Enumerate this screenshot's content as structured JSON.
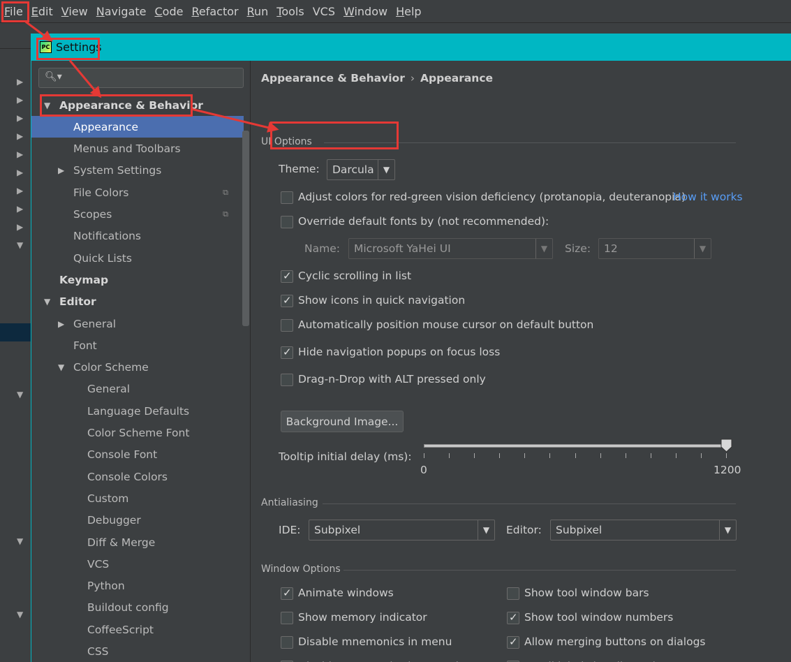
{
  "menu": {
    "items": [
      {
        "label": "File",
        "u": "F",
        "rest": "ile"
      },
      {
        "label": "Edit",
        "u": "E",
        "rest": "dit"
      },
      {
        "label": "View",
        "u": "V",
        "rest": "iew"
      },
      {
        "label": "Navigate",
        "u": "N",
        "rest": "avigate"
      },
      {
        "label": "Code",
        "u": "C",
        "rest": "ode"
      },
      {
        "label": "Refactor",
        "u": "R",
        "rest": "efactor"
      },
      {
        "label": "Run",
        "u": "R",
        "rest": "un"
      },
      {
        "label": "Tools",
        "u": "T",
        "rest": "ools"
      },
      {
        "label": "VCS",
        "u": "",
        "rest": "VCS"
      },
      {
        "label": "Window",
        "u": "W",
        "rest": "indow"
      },
      {
        "label": "Help",
        "u": "H",
        "rest": "elp"
      }
    ]
  },
  "dialog": {
    "title": "Settings",
    "search_placeholder": "",
    "tree": [
      {
        "label": "Appearance & Behavior",
        "level": 0,
        "arrow": "▼",
        "bold": true,
        "selected": false
      },
      {
        "label": "Appearance",
        "level": 1,
        "arrow": "",
        "bold": false,
        "selected": true
      },
      {
        "label": "Menus and Toolbars",
        "level": 1,
        "arrow": "",
        "bold": false,
        "selected": false
      },
      {
        "label": "System Settings",
        "level": 1,
        "arrow": "▶",
        "bold": false,
        "selected": false
      },
      {
        "label": "File Colors",
        "level": 1,
        "arrow": "",
        "bold": false,
        "selected": false,
        "copy": true
      },
      {
        "label": "Scopes",
        "level": 1,
        "arrow": "",
        "bold": false,
        "selected": false,
        "copy": true
      },
      {
        "label": "Notifications",
        "level": 1,
        "arrow": "",
        "bold": false,
        "selected": false
      },
      {
        "label": "Quick Lists",
        "level": 1,
        "arrow": "",
        "bold": false,
        "selected": false
      },
      {
        "label": "Keymap",
        "level": 0,
        "arrow": "",
        "bold": true,
        "selected": false
      },
      {
        "label": "Editor",
        "level": 0,
        "arrow": "▼",
        "bold": true,
        "selected": false
      },
      {
        "label": "General",
        "level": 1,
        "arrow": "▶",
        "bold": false,
        "selected": false
      },
      {
        "label": "Font",
        "level": 1,
        "arrow": "",
        "bold": false,
        "selected": false
      },
      {
        "label": "Color Scheme",
        "level": 1,
        "arrow": "▼",
        "bold": false,
        "selected": false
      },
      {
        "label": "General",
        "level": 2,
        "arrow": "",
        "bold": false,
        "selected": false
      },
      {
        "label": "Language Defaults",
        "level": 2,
        "arrow": "",
        "bold": false,
        "selected": false
      },
      {
        "label": "Color Scheme Font",
        "level": 2,
        "arrow": "",
        "bold": false,
        "selected": false
      },
      {
        "label": "Console Font",
        "level": 2,
        "arrow": "",
        "bold": false,
        "selected": false
      },
      {
        "label": "Console Colors",
        "level": 2,
        "arrow": "",
        "bold": false,
        "selected": false
      },
      {
        "label": "Custom",
        "level": 2,
        "arrow": "",
        "bold": false,
        "selected": false
      },
      {
        "label": "Debugger",
        "level": 2,
        "arrow": "",
        "bold": false,
        "selected": false
      },
      {
        "label": "Diff & Merge",
        "level": 2,
        "arrow": "",
        "bold": false,
        "selected": false
      },
      {
        "label": "VCS",
        "level": 2,
        "arrow": "",
        "bold": false,
        "selected": false
      },
      {
        "label": "Python",
        "level": 2,
        "arrow": "",
        "bold": false,
        "selected": false
      },
      {
        "label": "Buildout config",
        "level": 2,
        "arrow": "",
        "bold": false,
        "selected": false
      },
      {
        "label": "CoffeeScript",
        "level": 2,
        "arrow": "",
        "bold": false,
        "selected": false
      },
      {
        "label": "CSS",
        "level": 2,
        "arrow": "",
        "bold": false,
        "selected": false
      }
    ]
  },
  "content": {
    "breadcrumb_parent": "Appearance & Behavior",
    "breadcrumb_sep": "›",
    "breadcrumb_current": "Appearance",
    "ui_options": {
      "section": "UI Options",
      "theme_label": "Theme:",
      "theme_value": "Darcula",
      "adjust_colors": {
        "label": "Adjust colors for red-green vision deficiency (protanopia, deuteranopia)",
        "checked": false
      },
      "how_it_works": "How it works",
      "override_fonts": {
        "label": "Override default fonts by (not recommended):",
        "checked": false
      },
      "name_label": "Name:",
      "name_value": "Microsoft YaHei UI",
      "size_label": "Size:",
      "size_value": "12",
      "cyclic": {
        "label": "Cyclic scrolling in list",
        "checked": true
      },
      "show_icons": {
        "label": "Show icons in quick navigation",
        "checked": true
      },
      "auto_position": {
        "label": "Automatically position mouse cursor on default button",
        "checked": false
      },
      "hide_nav": {
        "label": "Hide navigation popups on focus loss",
        "checked": true
      },
      "drag_drop": {
        "label": "Drag-n-Drop with ALT pressed only",
        "checked": false
      },
      "background_image": "Background Image...",
      "tooltip_label": "Tooltip initial delay (ms):",
      "tooltip_min": "0",
      "tooltip_max": "1200",
      "tooltip_value": 1200
    },
    "antialiasing": {
      "section": "Antialiasing",
      "ide_label": "IDE:",
      "ide_value": "Subpixel",
      "editor_label": "Editor:",
      "editor_value": "Subpixel"
    },
    "window_options": {
      "section": "Window Options",
      "left": [
        {
          "label": "Animate windows",
          "checked": true
        },
        {
          "label": "Show memory indicator",
          "checked": false
        },
        {
          "label": "Disable mnemonics in menu",
          "checked": false
        },
        {
          "label": "Disable mnemonics in controls",
          "checked": false
        }
      ],
      "right": [
        {
          "label": "Show tool window bars",
          "checked": false
        },
        {
          "label": "Show tool window numbers",
          "checked": true
        },
        {
          "label": "Allow merging buttons on dialogs",
          "checked": true
        },
        {
          "label": "Small labels in editor tabs",
          "checked": false
        }
      ]
    }
  },
  "colors": {
    "accent": "#00b7c3",
    "selection": "#4b6eaf",
    "annotation": "#e53935",
    "link": "#589df6"
  }
}
